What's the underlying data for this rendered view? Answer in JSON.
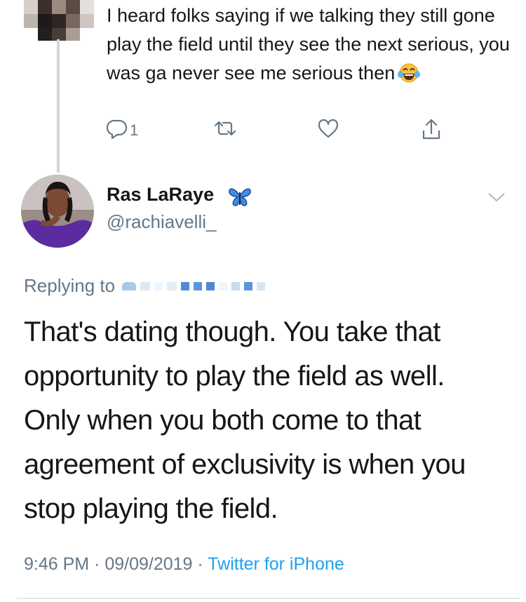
{
  "parent_tweet": {
    "text": "I heard folks saying if we talking they still gone play the field until they see the next serious, you was ga never see me serious then",
    "emoji": "face-with-tears-of-joy",
    "reply_count": "1"
  },
  "reply_tweet": {
    "display_name": "Ras LaRaye",
    "handle": "@rachiavelli_",
    "replying_to_label": "Replying to",
    "body": "That's dating though. You take that opportunity to play the field as well. Only when you both come to that agreement of exclusivity is when you stop playing the field.",
    "time": "9:46 PM",
    "sep1": "·",
    "date": "09/09/2019",
    "sep2": "·",
    "source": "Twitter for iPhone"
  },
  "colors": {
    "text": "#14171a",
    "secondary": "#657786",
    "link": "#1da1f2",
    "thread_line": "#ccd6dd"
  }
}
